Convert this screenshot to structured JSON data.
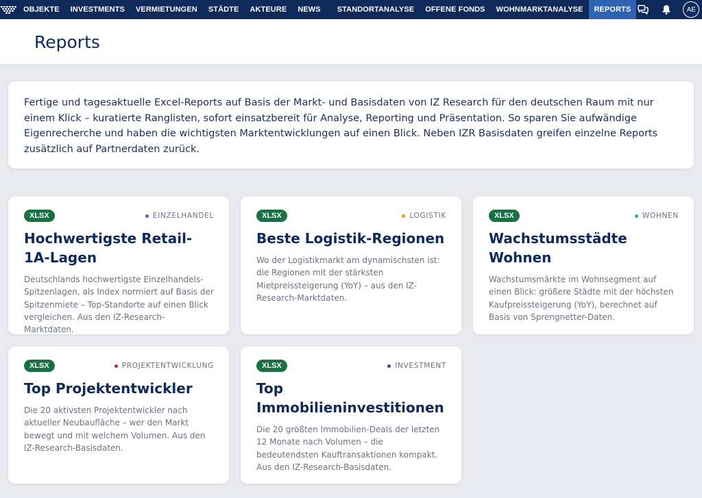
{
  "nav": {
    "items": [
      {
        "label": "OBJEKTE"
      },
      {
        "label": "INVESTMENTS"
      },
      {
        "label": "VERMIETUNGEN"
      },
      {
        "label": "STÄDTE"
      },
      {
        "label": "AKTEURE"
      },
      {
        "label": "NEWS"
      },
      {
        "label": "STANDORTANALYSE"
      },
      {
        "label": "OFFENE FONDS"
      },
      {
        "label": "WOHNMARKTANALYSE"
      },
      {
        "label": "REPORTS",
        "active": true
      }
    ],
    "avatar_initials": "AE",
    "icons": [
      "izr-logo-icon",
      "chat-icon",
      "bell-icon"
    ]
  },
  "page": {
    "title": "Reports"
  },
  "intro": {
    "text": "Fertige und tagesaktuelle Excel-Reports auf Basis der Markt- und Basisdaten von IZ Research für den deutschen Raum mit nur einem Klick – kuratierte Ranglisten, sofort einsatzbereit für Analyse, Reporting und Präsentation. So sparen Sie aufwändige Eigenrecherche und haben die wichtigsten Marktentwicklungen auf einen Blick. Neben IZR Basisdaten greifen einzelne Reports zusätzlich auf Partnerdaten zurück."
  },
  "colors": {
    "nav_bg": "#0e2a5a",
    "nav_active": "#2e63b2",
    "badge": "#197044",
    "page_bg": "#e9eaef"
  },
  "cards": [
    {
      "format": "XLSX",
      "category": "EINZELHANDEL",
      "category_color": "#3b6fb5",
      "title": "Hochwertigste Retail-1A-Lagen",
      "description": "Deutschlands hochwertigste Einzelhandels-Spitzenlagen, als Index normiert auf Basis der Spitzenmiete – Top-Standorte auf einen Blick vergleichen. Aus den IZ-Research-Marktdaten."
    },
    {
      "format": "XLSX",
      "category": "LOGISTIK",
      "category_color": "#e5a01b",
      "title": "Beste Logistik-Regionen",
      "description": "Wo der Logistikmarkt am dynamischsten ist: die Regionen mit der stärksten Mietpreissteigerung (YoY) – aus den IZ-Research-Marktdaten."
    },
    {
      "format": "XLSX",
      "category": "WOHNEN",
      "category_color": "#2fae8e",
      "title": "Wachstumsstädte Wohnen",
      "description": "Wachstumsmärkte im Wohnsegment auf einen Blick: größere Städte mit der höchsten Kaufpreissteigerung (YoY), berechnet auf Basis von Sprengnetter-Daten."
    },
    {
      "format": "XLSX",
      "category": "PROJEKTENTWICKLUNG",
      "category_color": "#c0264a",
      "title": "Top Projektentwickler",
      "description": "Die 20 aktivsten Projektentwickler nach aktueller Neubaufläche – wer den Markt bewegt und mit welchem Volumen. Aus den IZ-Research-Basisdaten."
    },
    {
      "format": "XLSX",
      "category": "INVESTMENT",
      "category_color": "#3a4a9a",
      "title": "Top Immobilieninvestitionen",
      "description": "Die 20 größten Immobilien-Deals der letzten 12 Monate nach Volumen – die bedeutendsten Kauftransaktionen kompakt. Aus den IZ-Research-Basisdaten."
    }
  ]
}
